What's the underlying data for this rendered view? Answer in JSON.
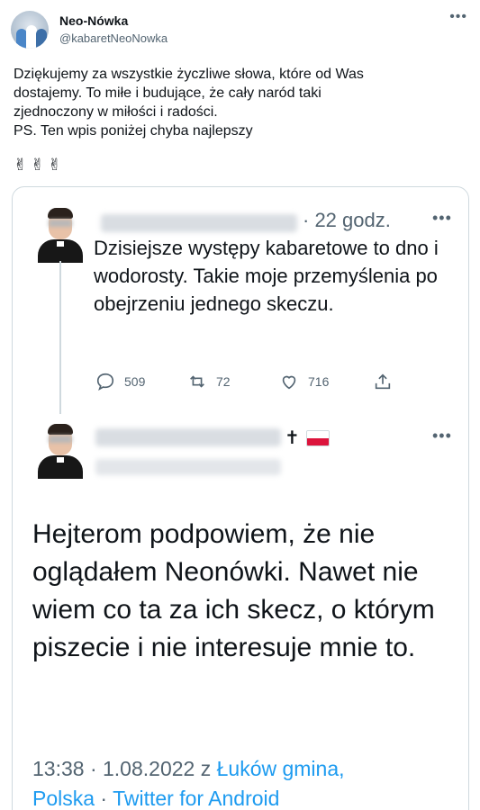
{
  "tweet": {
    "display_name": "Neo-Nówka",
    "handle": "@kabaretNeoNowka",
    "text_lines": [
      "Dziękujemy za wszystkie życzliwe słowa, które od Was",
      "dostajemy. To miłe i budujące, że cały naród taki",
      "zjednoczony w miłości i radości.",
      "PS. Ten wpis poniżej chyba najlepszy"
    ],
    "emojis": "✌✌✌",
    "more_icon": "more-horizontal-icon"
  },
  "screenshot": {
    "reply1": {
      "time": "· 22 godz.",
      "text": "Dzisiejsze występy kabaretowe to dno i wodorosty. Takie moje przemyślenia po obejrzeniu jednego skeczu.",
      "stats": {
        "replies": "509",
        "retweets": "72",
        "likes": "716"
      }
    },
    "reply2": {
      "name_symbols": "✝",
      "text": "Hejterom podpowiem, że nie oglądałem Neonówki. Nawet nie wiem co ta za ich skecz, o którym piszecie i nie interesuje mnie to.",
      "meta_time": "13:38 · 1.08.2022 z ",
      "meta_location": "Łuków gmina,",
      "meta_location2": "Polska",
      "meta_sep": " · ",
      "meta_source": "Twitter for Android"
    }
  },
  "colors": {
    "text_primary": "#0f1419",
    "text_secondary": "#536471",
    "link": "#1d9bf0",
    "border": "#cfd9de"
  }
}
